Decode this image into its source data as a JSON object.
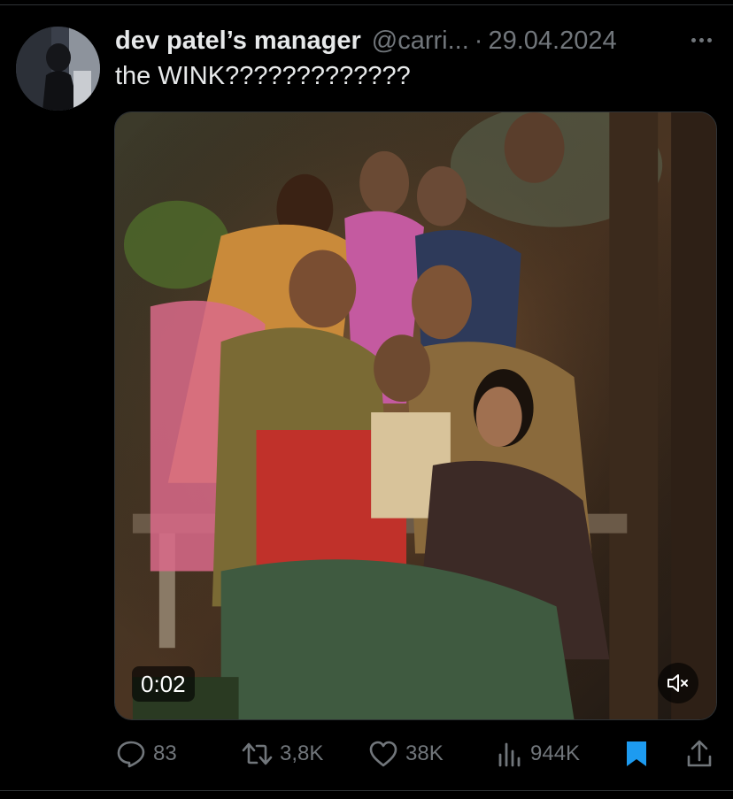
{
  "tweet": {
    "display_name": "dev patel’s manager",
    "handle": "@carri...",
    "separator": "·",
    "date": "29.04.2024",
    "text": "the WINK?????????????"
  },
  "media": {
    "duration": "0:02",
    "muted": true
  },
  "actions": {
    "replies": "83",
    "reposts": "3,8K",
    "likes": "38K",
    "views": "944K",
    "bookmarked": true
  },
  "colors": {
    "background": "#000000",
    "text_primary": "#e7e9ea",
    "text_secondary": "#71767b",
    "bookmark_active": "#1d9bf0",
    "divider": "#2f3336"
  },
  "icons": {
    "more": "more-icon",
    "mute": "mute-icon",
    "reply": "reply-icon",
    "repost": "repost-icon",
    "like": "heart-icon",
    "views": "views-icon",
    "bookmark": "bookmark-icon",
    "share": "share-icon"
  }
}
